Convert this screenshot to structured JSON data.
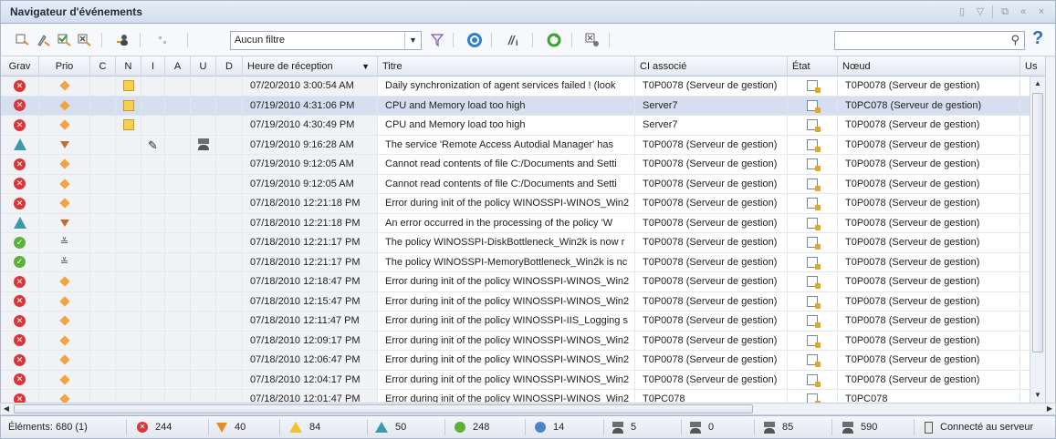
{
  "window": {
    "title": "Navigateur d'événements"
  },
  "toolbar": {
    "filter_value": "Aucun filtre",
    "search_placeholder": "",
    "help_label": "?"
  },
  "columns": [
    "Grav",
    "Prio",
    "C",
    "N",
    "I",
    "A",
    "U",
    "D",
    "Heure de réception",
    "Titre",
    "CI associé",
    "État",
    "Nœud",
    "Us"
  ],
  "rows": [
    {
      "sev": "critical",
      "prio": "medium",
      "note": true,
      "instr": false,
      "user": false,
      "time": "07/20/2010 3:00:54 AM",
      "title": "Daily synchronization of agent services failed ! (look",
      "ci": "T0P0078 (Serveur de gestion)",
      "node": "T0P0078 (Serveur de gestion)",
      "selected": false
    },
    {
      "sev": "critical",
      "prio": "medium",
      "note": true,
      "instr": false,
      "user": false,
      "time": "07/19/2010 4:31:06 PM",
      "title": "CPU and Memory load too high",
      "ci": "Server7",
      "node": "T0PC078 (Serveur de gestion)",
      "selected": true
    },
    {
      "sev": "critical",
      "prio": "medium",
      "note": true,
      "instr": false,
      "user": false,
      "time": "07/19/2010 4:30:49 PM",
      "title": "CPU and Memory load too high",
      "ci": "Server7",
      "node": "T0P0078 (Serveur de gestion)",
      "selected": false
    },
    {
      "sev": "warning",
      "prio": "low",
      "note": false,
      "instr": true,
      "user": true,
      "time": "07/19/2010 9:16:28 AM",
      "title": "The service 'Remote Access Autodial Manager' has",
      "ci": "T0P0078 (Serveur de gestion)",
      "node": "T0P0078 (Serveur de gestion)",
      "selected": false
    },
    {
      "sev": "critical",
      "prio": "medium",
      "note": false,
      "instr": false,
      "user": false,
      "time": "07/19/2010 9:12:05 AM",
      "title": "Cannot read contents of file C:/Documents and Setti",
      "ci": "T0P0078 (Serveur de gestion)",
      "node": "T0P0078 (Serveur de gestion)",
      "selected": false
    },
    {
      "sev": "critical",
      "prio": "medium",
      "note": false,
      "instr": false,
      "user": false,
      "time": "07/19/2010 9:12:05 AM",
      "title": "Cannot read contents of file C:/Documents and Setti",
      "ci": "T0P0078 (Serveur de gestion)",
      "node": "T0P0078 (Serveur de gestion)",
      "selected": false
    },
    {
      "sev": "critical",
      "prio": "medium",
      "note": false,
      "instr": false,
      "user": false,
      "time": "07/18/2010 12:21:18 PM",
      "title": "Error during init of the policy WINOSSPI-WINOS_Win2",
      "ci": "T0P0078 (Serveur de gestion)",
      "node": "T0P0078 (Serveur de gestion)",
      "selected": false
    },
    {
      "sev": "warning",
      "prio": "low",
      "note": false,
      "instr": false,
      "user": false,
      "time": "07/18/2010 12:21:18 PM",
      "title": "An error occurred in the processing of the policy 'W",
      "ci": "T0P0078 (Serveur de gestion)",
      "node": "T0P0078 (Serveur de gestion)",
      "selected": false
    },
    {
      "sev": "normal",
      "prio": "lowest",
      "note": false,
      "instr": false,
      "user": false,
      "time": "07/18/2010 12:21:17 PM",
      "title": "The policy WINOSSPI-DiskBottleneck_Win2k is now r",
      "ci": "T0P0078 (Serveur de gestion)",
      "node": "T0P0078 (Serveur de gestion)",
      "selected": false
    },
    {
      "sev": "normal",
      "prio": "lowest",
      "note": false,
      "instr": false,
      "user": false,
      "time": "07/18/2010 12:21:17 PM",
      "title": "The policy WINOSSPI-MemoryBottleneck_Win2k is nc",
      "ci": "T0P0078 (Serveur de gestion)",
      "node": "T0P0078 (Serveur de gestion)",
      "selected": false
    },
    {
      "sev": "critical",
      "prio": "medium",
      "note": false,
      "instr": false,
      "user": false,
      "time": "07/18/2010 12:18:47 PM",
      "title": "Error during init of the policy WINOSSPI-WINOS_Win2",
      "ci": "T0P0078 (Serveur de gestion)",
      "node": "T0P0078 (Serveur de gestion)",
      "selected": false
    },
    {
      "sev": "critical",
      "prio": "medium",
      "note": false,
      "instr": false,
      "user": false,
      "time": "07/18/2010 12:15:47 PM",
      "title": "Error during init of the policy WINOSSPI-WINOS_Win2",
      "ci": "T0P0078 (Serveur de gestion)",
      "node": "T0P0078 (Serveur de gestion)",
      "selected": false
    },
    {
      "sev": "critical",
      "prio": "medium",
      "note": false,
      "instr": false,
      "user": false,
      "time": "07/18/2010 12:11:47 PM",
      "title": "Error during init of the policy WINOSSPI-IIS_Logging s",
      "ci": "T0P0078 (Serveur de gestion)",
      "node": "T0P0078 (Serveur de gestion)",
      "selected": false
    },
    {
      "sev": "critical",
      "prio": "medium",
      "note": false,
      "instr": false,
      "user": false,
      "time": "07/18/2010 12:09:17 PM",
      "title": "Error during init of the policy WINOSSPI-WINOS_Win2",
      "ci": "T0P0078 (Serveur de gestion)",
      "node": "T0P0078 (Serveur de gestion)",
      "selected": false
    },
    {
      "sev": "critical",
      "prio": "medium",
      "note": false,
      "instr": false,
      "user": false,
      "time": "07/18/2010 12:06:47 PM",
      "title": "Error during init of the policy WINOSSPI-WINOS_Win2",
      "ci": "T0P0078 (Serveur de gestion)",
      "node": "T0P0078 (Serveur de gestion)",
      "selected": false
    },
    {
      "sev": "critical",
      "prio": "medium",
      "note": false,
      "instr": false,
      "user": false,
      "time": "07/18/2010 12:04:17 PM",
      "title": "Error during init of the policy WINOSSPI-WINOS_Win2",
      "ci": "T0P0078 (Serveur de gestion)",
      "node": "T0P0078 (Serveur de gestion)",
      "selected": false
    },
    {
      "sev": "critical",
      "prio": "medium",
      "note": false,
      "instr": false,
      "user": false,
      "time": "07/18/2010 12:01:47 PM",
      "title": "Error during init of the policy WINOSSPI-WINOS_Win2",
      "ci": "T0PC078",
      "node": "T0PC078",
      "selected": false
    }
  ],
  "status": {
    "elements": "Éléments: 680 (1)",
    "critical": "244",
    "major": "40",
    "minor": "84",
    "warning": "50",
    "normal": "248",
    "unknown": "14",
    "assigned_me": "5",
    "assigned_other": "0",
    "assigned_group": "85",
    "unassigned": "590",
    "connection": "Connecté au serveur"
  },
  "colors": {
    "critical": "#d8363a",
    "warning": "#3c9aa8",
    "normal": "#5cb239",
    "selected_row": "#d6dff0"
  }
}
